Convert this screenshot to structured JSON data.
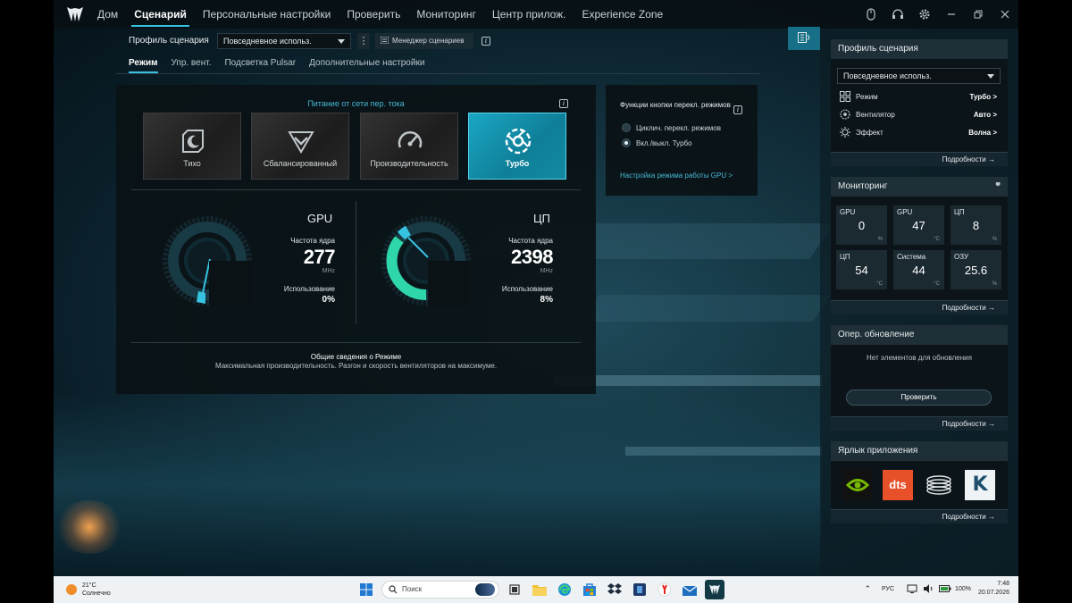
{
  "nav": {
    "items": [
      "Дом",
      "Сценарий",
      "Персональные настройки",
      "Проверить",
      "Мониторинг",
      "Центр прилож.",
      "Experience Zone"
    ],
    "active": 1
  },
  "window_icons": [
    "mouse-icon",
    "headset-icon",
    "settings-gear-icon",
    "minimize-icon",
    "restore-icon",
    "close-icon"
  ],
  "profile": {
    "label": "Профиль сценария",
    "value": "Повседневное использ.",
    "manager_label": "Менеджер сценариев"
  },
  "subtabs": {
    "items": [
      "Режим",
      "Упр. вент.",
      "Подсветка Pulsar",
      "Дополнительные настройки"
    ],
    "active": 0
  },
  "power": {
    "title": "Питание от сети пер. тока",
    "modes": [
      "Тихо",
      "Сбалансированный",
      "Производительность",
      "Турбо"
    ],
    "active": 3
  },
  "gpu_gauge": {
    "title": "GPU",
    "freq_label": "Частота ядра",
    "freq": "277",
    "unit": "MHz",
    "usage_label": "Использование",
    "usage": "0%"
  },
  "cpu_gauge": {
    "title": "ЦП",
    "freq_label": "Частота ядра",
    "freq": "2398",
    "unit": "MHz",
    "usage_label": "Использование",
    "usage": "8%"
  },
  "summary": {
    "title": "Общие сведения о Режиме",
    "text": "Максимальная производительность. Разгон и скорость вентиляторов на максимуме."
  },
  "functions": {
    "title": "Функции кнопки перекл. режимов",
    "options": [
      "Циклич. перекл. режимов",
      "Вкл./выкл. Турбо"
    ],
    "selected": 1,
    "link": "Настройка режима работы GPU >"
  },
  "sidebar": {
    "profile_card": {
      "title": "Профиль сценария",
      "dropdown": "Повседневное использ.",
      "rows": [
        {
          "label": "Режим",
          "value": "Турбо >",
          "icon": "mode-grid-icon"
        },
        {
          "label": "Вентилятор",
          "value": "Авто >",
          "icon": "fan-icon"
        },
        {
          "label": "Эффект",
          "value": "Волна >",
          "icon": "effect-sun-icon"
        }
      ],
      "footer": "Подробности →"
    },
    "monitoring_card": {
      "title": "Мониторинг",
      "cells": [
        {
          "label": "GPU",
          "value": "0",
          "unit": "%"
        },
        {
          "label": "GPU",
          "value": "47",
          "unit": "°C"
        },
        {
          "label": "ЦП",
          "value": "8",
          "unit": "%"
        },
        {
          "label": "ЦП",
          "value": "54",
          "unit": "°C"
        },
        {
          "label": "Система",
          "value": "44",
          "unit": "°C"
        },
        {
          "label": "ОЗУ",
          "value": "25.6",
          "unit": "%"
        }
      ],
      "footer": "Подробности →"
    },
    "update_card": {
      "title": "Опер. обновление",
      "empty_text": "Нет элементов для обновления",
      "button": "Проверить",
      "footer": "Подробности →"
    },
    "shortcut_card": {
      "title": "Ярлык приложения",
      "apps": [
        "nvidia-icon",
        "dts-icon",
        "disc-stack-icon",
        "k-app-icon"
      ],
      "dts_text": "dts",
      "k_text": "K",
      "footer": "Подробности →"
    }
  },
  "taskbar": {
    "temp": "21°C",
    "weather": "Солнечно",
    "search": "Поиск",
    "lang": "РУС",
    "battery": "100%",
    "time": "7:48",
    "date": "20.07.2026"
  },
  "colors": {
    "accent": "#36c2e0",
    "turbo": "#1aa6c4",
    "gauge_cpu": "#2fd7a8"
  }
}
